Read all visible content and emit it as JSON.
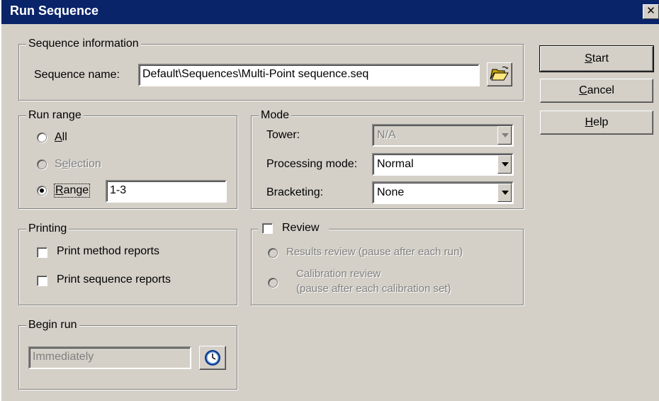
{
  "window": {
    "title": "Run Sequence",
    "close_glyph": "✕"
  },
  "sequence_info": {
    "legend": "Sequence information",
    "name_label": "Sequence name:",
    "name_value": "Default\\Sequences\\Multi-Point sequence.seq",
    "browse_icon": "folder-open-icon"
  },
  "run_range": {
    "legend": "Run range",
    "options": [
      {
        "label": "All",
        "accel": "A",
        "rest": "ll",
        "selected": false,
        "enabled": true
      },
      {
        "label": "Selection",
        "accel": "e",
        "pre": "S",
        "rest": "lection",
        "selected": false,
        "enabled": false
      },
      {
        "label": "Range",
        "accel": "R",
        "rest": "ange",
        "selected": true,
        "enabled": true
      }
    ],
    "range_value": "1-3"
  },
  "mode": {
    "legend": "Mode",
    "tower_label": "Tower:",
    "tower_value": "N/A",
    "processing_label": "Processing mode:",
    "processing_value": "Normal",
    "bracketing_label": "Bracketing:",
    "bracketing_value": "None"
  },
  "printing": {
    "legend": "Printing",
    "method_reports": "Print method reports",
    "sequence_reports": "Print sequence reports"
  },
  "review": {
    "legend": "Review",
    "results_review": "Results review (pause after each run)",
    "calibration_review_line1": "Calibration review",
    "calibration_review_line2": "(pause after each calibration set)"
  },
  "begin_run": {
    "legend": "Begin run",
    "value": "Immediately",
    "clock_icon": "clock-icon"
  },
  "buttons": {
    "start": {
      "accel": "S",
      "rest": "tart"
    },
    "cancel": {
      "accel": "C",
      "rest": "ancel"
    },
    "help": {
      "accel": "H",
      "rest": "elp"
    }
  },
  "colors": {
    "title_bar": "#0a246a",
    "face": "#d4d0c8",
    "disabled_text": "#808080"
  }
}
